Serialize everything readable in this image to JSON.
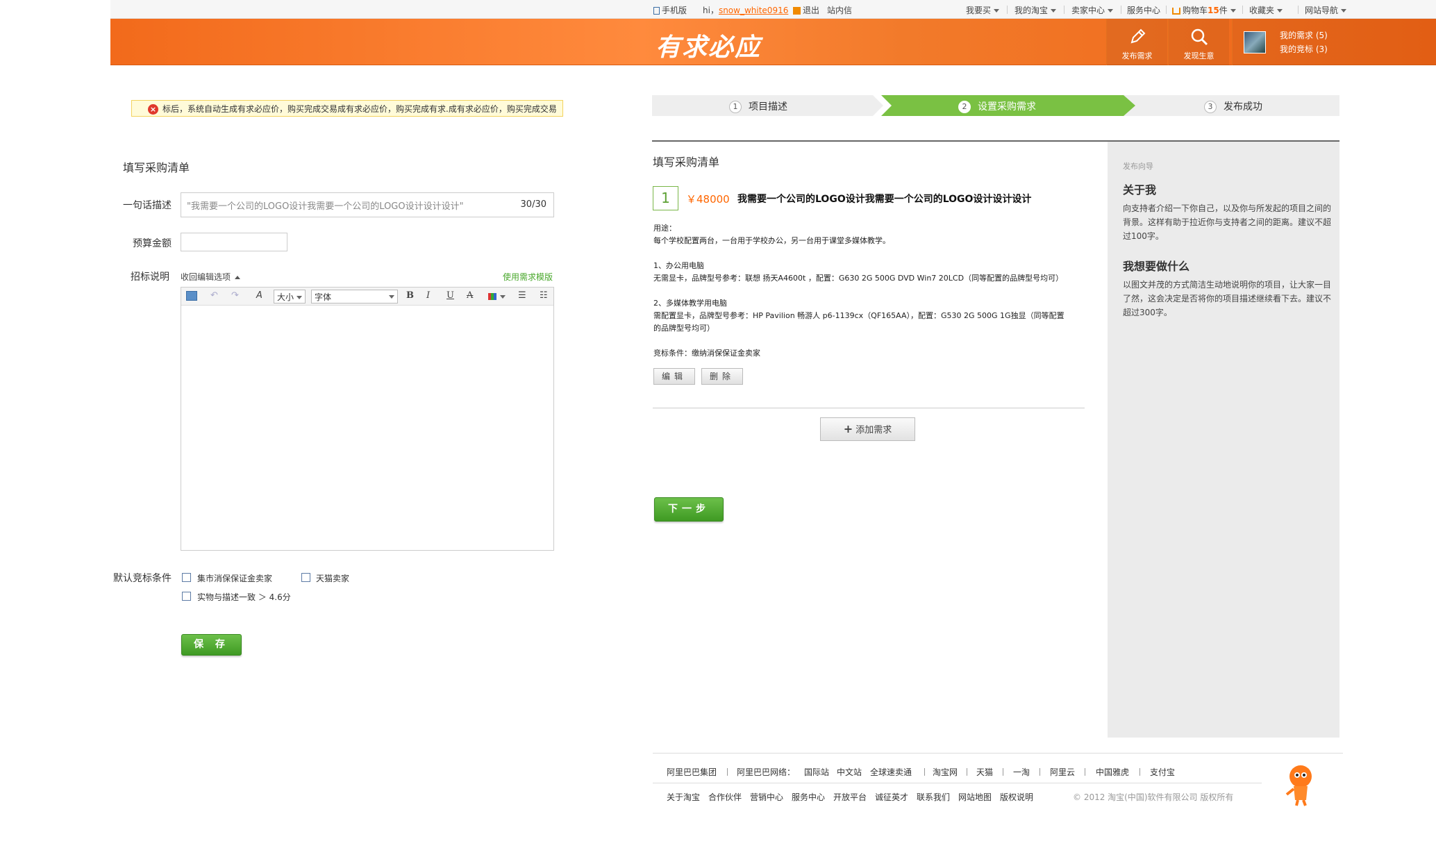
{
  "topbar": {
    "mobile": "手机版",
    "hi": "hi，",
    "username": "snow_white0916",
    "logout": "退出",
    "inbox": "站内信",
    "buy": "我要买",
    "my_taobao": "我的淘宝",
    "seller_center": "卖家中心",
    "service_center": "服务中心",
    "cart_prefix": "购物车",
    "cart_count": "15",
    "cart_suffix": "件",
    "favorites": "收藏夹",
    "site_nav": "网站导航"
  },
  "header": {
    "logo": "有求必应",
    "publish_label": "发布需求",
    "discover_label": "发现生意",
    "my_demands": "我的需求 (5)",
    "my_bids": "我的竞标 (3)"
  },
  "notice": {
    "text": "标后，系统自动生成有求必应价，购买完成交易成有求必应价，购买完成有求.成有求必应价，购买完成交易"
  },
  "left_form": {
    "title": "填写采购清单",
    "desc_label": "一句话描述",
    "desc_value": "\"我需要一个公司的LOGO设计我需要一个公司的LOGO设计设计设计\"",
    "desc_count": "30/30",
    "budget_label": "预算金额",
    "budget_value": "",
    "bid_label": "招标说明",
    "collapse_options": "收回编辑选项",
    "use_template": "使用需求模版",
    "toolbar_size": "大小",
    "toolbar_font": "字体",
    "conditions_label": "默认竞标条件",
    "cond1": "集市消保保证金卖家",
    "cond2": "天猫卖家",
    "cond3": "实物与描述一致 ＞ 4.6分",
    "save_button": "保 存"
  },
  "steps": [
    {
      "num": "1",
      "label": "项目描述"
    },
    {
      "num": "2",
      "label": "设置采购需求"
    },
    {
      "num": "3",
      "label": "发布成功"
    }
  ],
  "main": {
    "title": "填写采购清单",
    "req_number": "1",
    "req_price": "￥48000",
    "req_title": "我需要一个公司的LOGO设计我需要一个公司的LOGO设计设计设计",
    "usage_label": "用途：",
    "usage_text": "每个学校配置两台，一台用于学校办公，另一台用于课堂多媒体教学。",
    "item1_title": "1、办公用电脑",
    "item1_text": "无需显卡，品牌型号参考：联想 扬天A4600t ，配置：G630 2G 500G DVD Win7 20LCD（同等配置的品牌型号均可）",
    "item2_title": "2、多媒体教学用电脑",
    "item2_text_a": "需配置显卡，品牌型号参考：HP Pavilion 畅游人 p6-1139cx（QF165AA），配置：G530 2G 500G 1G独显（同等配置",
    "item2_text_b": "的品牌型号均可）",
    "bid_conditions": "竞标条件：缴纳消保保证金卖家",
    "edit_button": "编辑",
    "delete_button": "删除",
    "add_button": "添加需求",
    "next_button": "下一步"
  },
  "guide": {
    "small_title": "发布向导",
    "h1": "关于我",
    "p1": "向支持者介绍一下你自己，以及你与所发起的项目之间的背景。这样有助于拉近你与支持者之间的距离。建议不超过100字。",
    "h2": "我想要做什么",
    "p2": "以图文并茂的方式简洁生动地说明你的项目，让大家一目了然，这会决定是否将你的项目描述继续看下去。建议不超过300字。"
  },
  "footer": {
    "row1": [
      "阿里巴巴集团",
      "阿里巴巴网络：",
      "国际站",
      "中文站",
      "全球速卖通",
      "淘宝网",
      "天猫",
      "一淘",
      "阿里云",
      "中国雅虎",
      "支付宝"
    ],
    "row2": [
      "关于淘宝",
      "合作伙伴",
      "营销中心",
      "服务中心",
      "开放平台",
      "诚征英才",
      "联系我们",
      "网站地图",
      "版权说明"
    ],
    "copyright": "© 2012 淘宝(中国)软件有限公司 版权所有"
  },
  "colors": {
    "brand_orange": "#f26a1b",
    "active_step_green": "#7ac143",
    "button_green": "#4aa82c"
  }
}
